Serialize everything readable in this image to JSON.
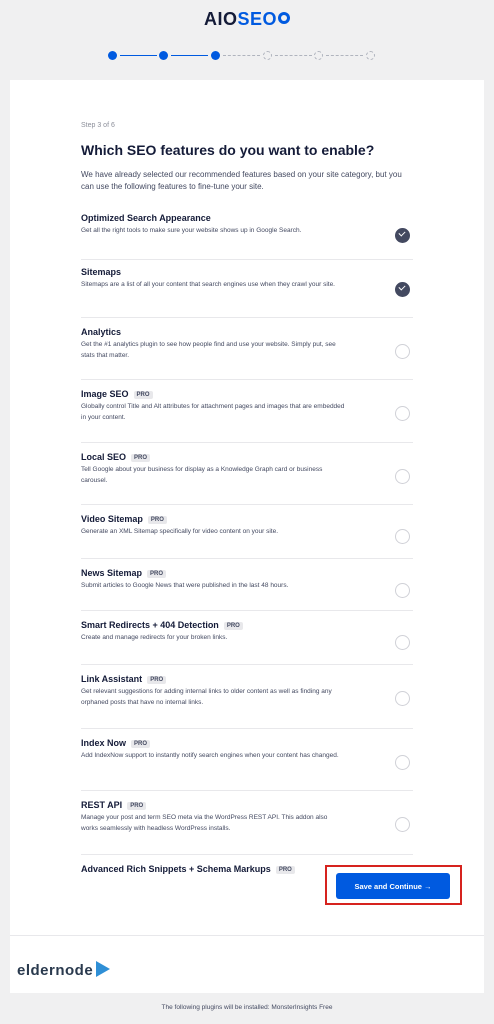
{
  "logo": {
    "part1": "AIO",
    "part2": "SEO"
  },
  "wizard": {
    "step_label": "Step 3 of 6",
    "heading": "Which SEO features do you want to enable?",
    "intro": "We have already selected our recommended features based on your site category, but you can use the following features to fine-tune your site."
  },
  "features": [
    {
      "title": "Optimized Search Appearance",
      "pro": "",
      "desc": "Get all the right tools to make sure your website shows up in Google Search.",
      "enabled": true
    },
    {
      "title": "Sitemaps",
      "pro": "",
      "desc": "Sitemaps are a list of all your content that search engines use when they crawl your site.",
      "enabled": true
    },
    {
      "title": "Analytics",
      "pro": "",
      "desc": "Get the #1 analytics plugin to see how people find and use your website. Simply put, see stats that matter.",
      "enabled": false
    },
    {
      "title": "Image SEO",
      "pro": "PRO",
      "desc": "Globally control Title and Alt attributes for attachment pages and images that are embedded in your content.",
      "enabled": false
    },
    {
      "title": "Local SEO",
      "pro": "PRO",
      "desc": "Tell Google about your business for display as a Knowledge Graph card or business carousel.",
      "enabled": false
    },
    {
      "title": "Video Sitemap",
      "pro": "PRO",
      "desc": "Generate an XML Sitemap specifically for video content on your site.",
      "enabled": false
    },
    {
      "title": "News Sitemap",
      "pro": "PRO",
      "desc": "Submit articles to Google News that were published in the last 48 hours.",
      "enabled": false
    },
    {
      "title": "Smart Redirects + 404 Detection",
      "pro": "PRO",
      "desc": "Create and manage redirects for your broken links.",
      "enabled": false
    },
    {
      "title": "Link Assistant",
      "pro": "PRO",
      "desc": "Get relevant suggestions for adding internal links to older content as well as finding any orphaned posts that have no internal links.",
      "enabled": false
    },
    {
      "title": "Index Now",
      "pro": "PRO",
      "desc": "Add IndexNow support to instantly notify search engines when your content has changed.",
      "enabled": false
    },
    {
      "title": "REST API",
      "pro": "PRO",
      "desc": "Manage your post and term SEO meta via the WordPress REST API. This addon also works seamlessly with headless WordPress installs.",
      "enabled": false
    },
    {
      "title": "Advanced Rich Snippets + Schema Markups",
      "pro": "PRO",
      "desc": "",
      "enabled": false
    }
  ],
  "footer": {
    "save_label": "Save and Continue →",
    "install_note": "The following plugins will be installed: MonsterInsights Free",
    "brand": "eldernode"
  },
  "colors": {
    "accent": "#005ae0",
    "highlight": "#d6231e",
    "text": "#141b38"
  }
}
